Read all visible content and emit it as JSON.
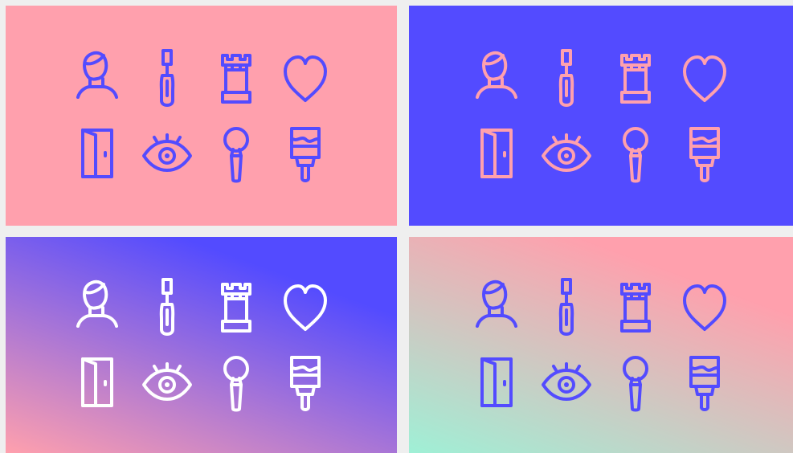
{
  "panels": [
    {
      "id": "solid-pink",
      "background": "#ffa0ad",
      "icon_color": "#534bff"
    },
    {
      "id": "solid-blue",
      "background": "#534bff",
      "icon_color": "#ffa0ad"
    },
    {
      "id": "gradient-pink-blue",
      "gradient_from": "#ffa0ad",
      "gradient_to": "#534bff",
      "icon_color": "#ffffff"
    },
    {
      "id": "gradient-mint-pink",
      "gradient_from": "#9ff0d6",
      "gradient_to": "#ffa0ad",
      "icon_color": "#534bff"
    }
  ],
  "icons": [
    "person-icon",
    "screwdriver-icon",
    "rook-icon",
    "heart-icon",
    "door-icon",
    "eye-icon",
    "magnifier-icon",
    "paintbrush-icon"
  ]
}
